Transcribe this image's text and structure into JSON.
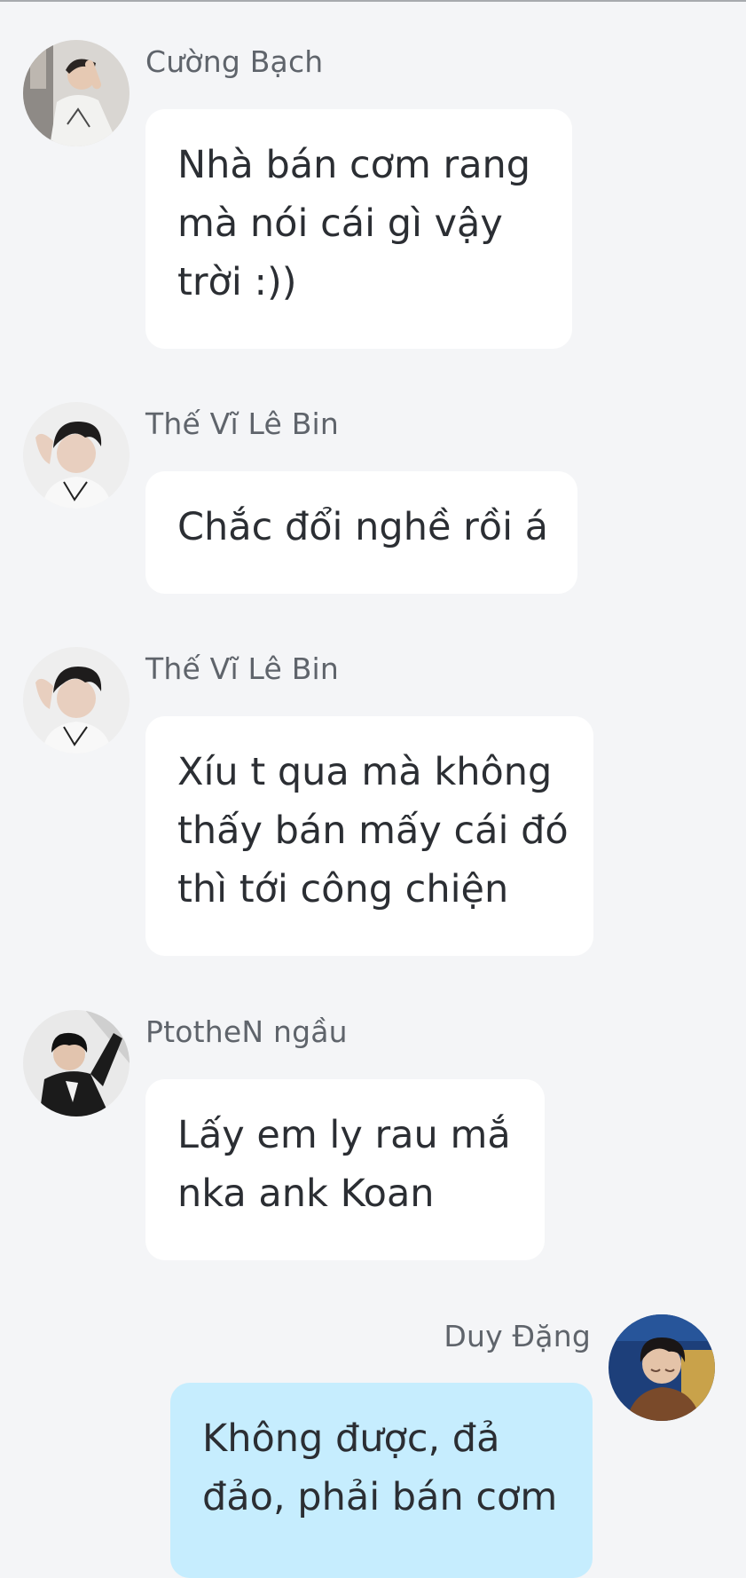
{
  "messages": [
    {
      "sender": "Cường Bạch",
      "avatar": "avatar-cuong-bach",
      "lines": [
        "Nhà bán cơm rang",
        "mà nói cái gì vậy",
        "trời :))"
      ]
    },
    {
      "sender": "Thế Vĩ Lê Bin",
      "avatar": "avatar-the-vi-le-bin",
      "lines": [
        "Chắc đổi nghề rồi á"
      ]
    },
    {
      "sender": "Thế Vĩ Lê Bin",
      "avatar": "avatar-the-vi-le-bin",
      "lines": [
        "Xíu t qua mà không",
        "thấy bán mấy cái đó",
        "thì tới công chiện"
      ]
    },
    {
      "sender": "PtotheN ngầu",
      "avatar": "avatar-ptothen-ngau",
      "lines": [
        "Lấy em ly rau mắ",
        "nka ank Koan"
      ]
    },
    {
      "sender": "Duy Đặng",
      "avatar": "avatar-duy-dang",
      "lines": [
        "Không được, đả",
        "đảo, phải bán cơm"
      ]
    }
  ],
  "colors": {
    "background": "#f4f5f7",
    "bubble_incoming": "#ffffff",
    "bubble_outgoing": "#c6edfe",
    "sender_text": "#5f646b",
    "message_text": "#2b2e33"
  }
}
